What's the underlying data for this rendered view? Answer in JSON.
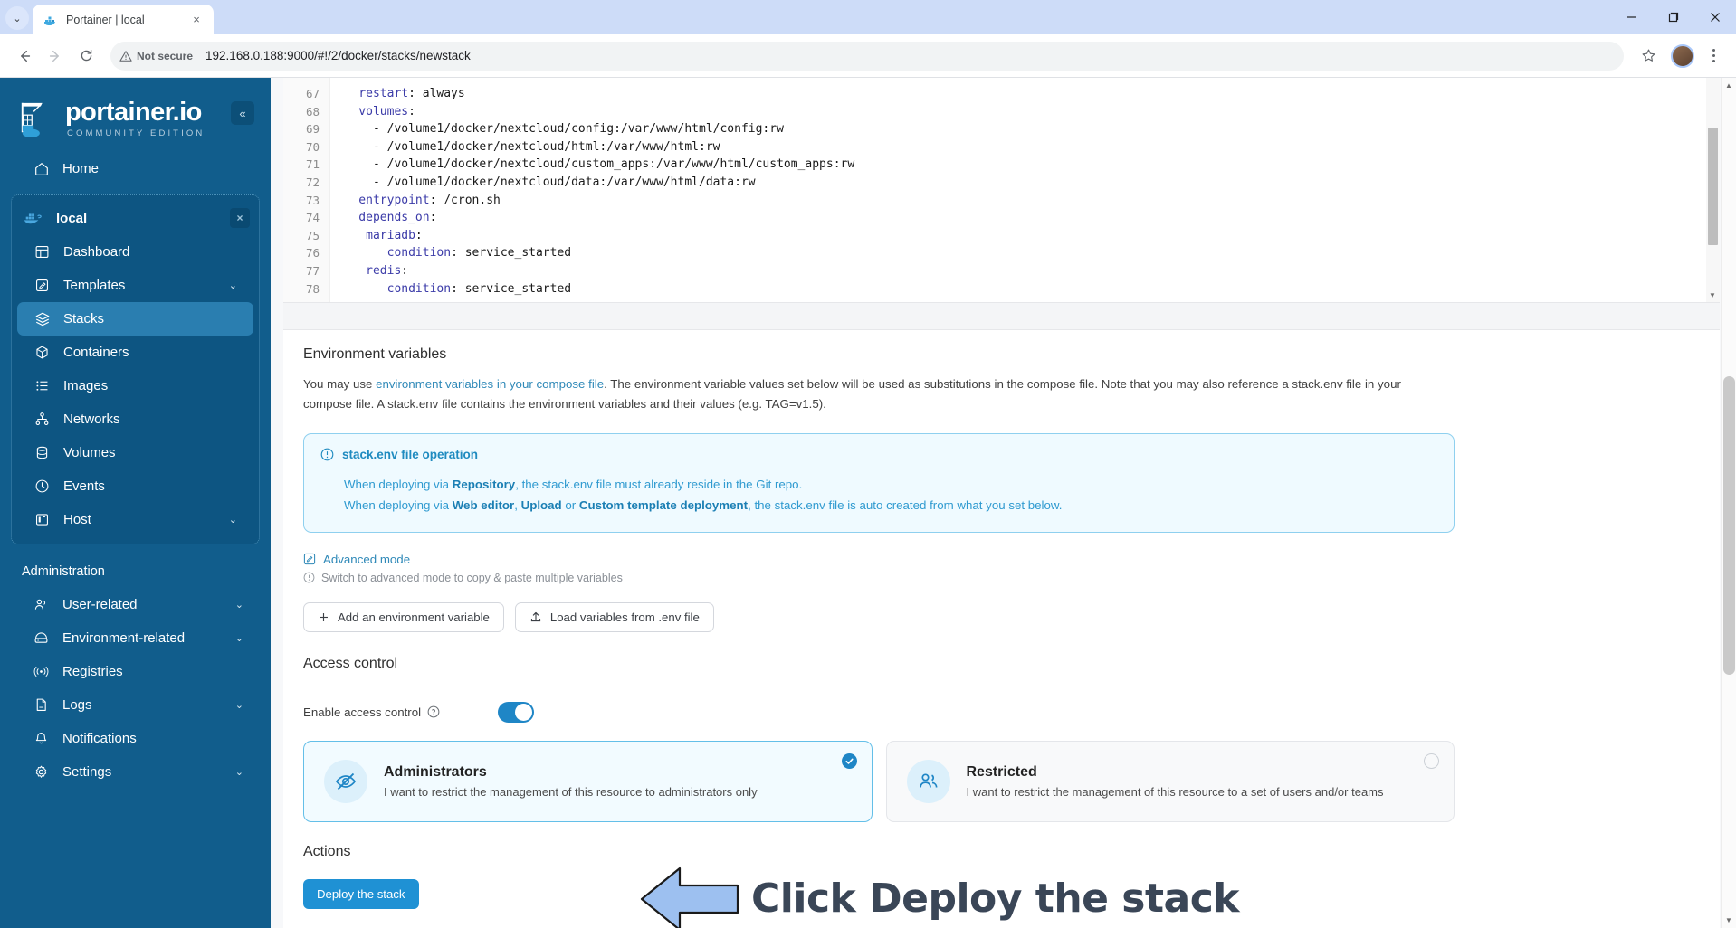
{
  "browser": {
    "tab_title": "Portainer | local",
    "tab_favicon": "portainer-whale-icon",
    "tab_close": "×",
    "tabstrip_chevron": "⌄",
    "back": "←",
    "forward": "→",
    "reload": "⟳",
    "security_label": "Not secure",
    "url": "192.168.0.188:9000/#!/2/docker/stacks/newstack",
    "star": "☆",
    "minimize": "—",
    "maximize": "❐",
    "close": "✕"
  },
  "sidebar": {
    "logo_title": "portainer.io",
    "logo_sub": "COMMUNITY EDITION",
    "collapse": "«",
    "home": {
      "label": "Home",
      "icon": "home-icon"
    },
    "environment": {
      "name": "local",
      "icon": "docker-whale-icon",
      "close": "×"
    },
    "env_items": [
      {
        "label": "Dashboard",
        "icon": "dashboard-icon",
        "chevron": ""
      },
      {
        "label": "Templates",
        "icon": "templates-icon",
        "chevron": "⌄"
      },
      {
        "label": "Stacks",
        "icon": "stacks-icon",
        "chevron": ""
      },
      {
        "label": "Containers",
        "icon": "containers-icon",
        "chevron": ""
      },
      {
        "label": "Images",
        "icon": "images-icon",
        "chevron": ""
      },
      {
        "label": "Networks",
        "icon": "networks-icon",
        "chevron": ""
      },
      {
        "label": "Volumes",
        "icon": "volumes-icon",
        "chevron": ""
      },
      {
        "label": "Events",
        "icon": "events-icon",
        "chevron": ""
      },
      {
        "label": "Host",
        "icon": "host-icon",
        "chevron": "⌄"
      }
    ],
    "admin_label": "Administration",
    "admin_items": [
      {
        "label": "User-related",
        "icon": "users-icon",
        "chevron": "⌄"
      },
      {
        "label": "Environment-related",
        "icon": "environment-icon",
        "chevron": "⌄"
      },
      {
        "label": "Registries",
        "icon": "registries-icon",
        "chevron": ""
      },
      {
        "label": "Logs",
        "icon": "logs-icon",
        "chevron": "⌄"
      },
      {
        "label": "Notifications",
        "icon": "bell-icon",
        "chevron": ""
      },
      {
        "label": "Settings",
        "icon": "gear-icon",
        "chevron": "⌄"
      }
    ]
  },
  "editor": {
    "lines": [
      {
        "n": "67",
        "indent": 4,
        "key": "restart",
        "value": "always"
      },
      {
        "n": "68",
        "indent": 4,
        "key": "volumes",
        "value": ""
      },
      {
        "n": "69",
        "indent": 6,
        "key": "",
        "value": "- /volume1/docker/nextcloud/config:/var/www/html/config:rw"
      },
      {
        "n": "70",
        "indent": 6,
        "key": "",
        "value": "- /volume1/docker/nextcloud/html:/var/www/html:rw"
      },
      {
        "n": "71",
        "indent": 6,
        "key": "",
        "value": "- /volume1/docker/nextcloud/custom_apps:/var/www/html/custom_apps:rw"
      },
      {
        "n": "72",
        "indent": 6,
        "key": "",
        "value": "- /volume1/docker/nextcloud/data:/var/www/html/data:rw"
      },
      {
        "n": "73",
        "indent": 4,
        "key": "entrypoint",
        "value": "/cron.sh"
      },
      {
        "n": "74",
        "indent": 4,
        "key": "depends_on",
        "value": ""
      },
      {
        "n": "75",
        "indent": 5,
        "key": "mariadb",
        "value": ""
      },
      {
        "n": "76",
        "indent": 8,
        "key": "condition",
        "value": "service_started"
      },
      {
        "n": "77",
        "indent": 5,
        "key": "redis",
        "value": ""
      },
      {
        "n": "78",
        "indent": 8,
        "key": "condition",
        "value": "service_started"
      }
    ]
  },
  "env_section": {
    "title": "Environment variables",
    "para_1": "You may use ",
    "para_link": "environment variables in your compose file",
    "para_2": ". The environment variable values set below will be used as substitutions in the compose file. Note that you may also reference a stack.env file in your compose file. A stack.env file contains the environment variables and their values (e.g. TAG=v1.5).",
    "info": {
      "icon": "info-circle-icon",
      "title": "stack.env file operation",
      "line1_a": "When deploying via ",
      "line1_b": "Repository",
      "line1_c": ", the stack.env file must already reside in the Git repo.",
      "line2_a": "When deploying via ",
      "line2_b": "Web editor",
      "line2_c": ", ",
      "line2_d": "Upload",
      "line2_e": " or ",
      "line2_f": "Custom template deployment",
      "line2_g": ", the stack.env file is auto created from what you set below."
    },
    "advanced_mode": "Advanced mode",
    "advanced_icon": "edit-square-icon",
    "advanced_hint": "Switch to advanced mode to copy & paste multiple variables",
    "advanced_hint_icon": "info-circle-icon",
    "buttons": [
      {
        "label": "Add an environment variable",
        "icon": "plus-icon"
      },
      {
        "label": "Load variables from .env file",
        "icon": "upload-icon"
      }
    ]
  },
  "access_control": {
    "title": "Access control",
    "enable_label": "Enable access control",
    "help_icon": "question-circle-icon",
    "toggle_on": true,
    "cards": [
      {
        "title": "Administrators",
        "desc": "I want to restrict the management of this resource to administrators only",
        "icon": "eye-off-icon",
        "selected": true
      },
      {
        "title": "Restricted",
        "desc": "I want to restrict the management of this resource to a set of users and/or teams",
        "icon": "users-group-icon",
        "selected": false
      }
    ]
  },
  "actions": {
    "title": "Actions",
    "deploy_label": "Deploy the stack"
  },
  "annotation": {
    "text": "Click Deploy the stack",
    "arrow": "left-arrow-annotation",
    "arrow_fill": "#9dc0f0",
    "arrow_stroke": "#1a1a1a",
    "text_color": "#3a4657"
  },
  "colors": {
    "sidebar_bg": "#115d8c",
    "sidebar_active": "#2a7eb0",
    "accent": "#1f91d4",
    "link": "#2f89b8",
    "info_bg": "#effaff",
    "info_border": "#8fd0ef"
  }
}
